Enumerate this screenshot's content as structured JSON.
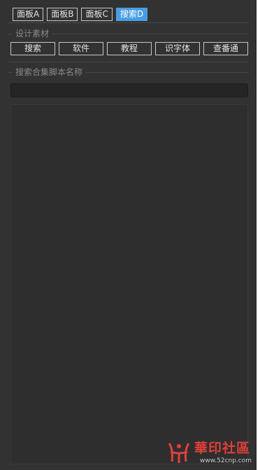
{
  "tabs": [
    {
      "label": "面板A",
      "active": false
    },
    {
      "label": "面板B",
      "active": false
    },
    {
      "label": "面板C",
      "active": false
    },
    {
      "label": "搜索D",
      "active": true
    }
  ],
  "design_group": {
    "title": "设计素材",
    "buttons": [
      "搜索",
      "软件",
      "教程",
      "识字体",
      "查番通"
    ]
  },
  "search_group": {
    "title": "搜索合集脚本名称",
    "input_value": "",
    "results": []
  },
  "colors": {
    "panel_bg": "#323232",
    "active_tab": "#4a9de3",
    "watermark": "#e0403a"
  },
  "watermark": {
    "title": "華印社區",
    "url": "www.52cnp.com"
  }
}
